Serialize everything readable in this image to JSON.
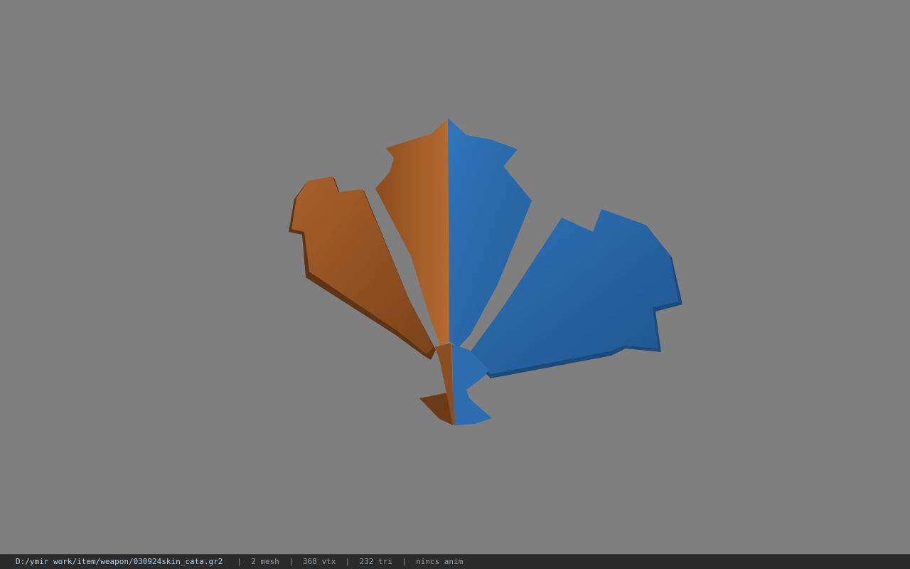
{
  "viewport": {
    "background": "#7f7f7f",
    "model": {
      "meshes": [
        {
          "name": "orange-mesh",
          "color": "#b0642a"
        },
        {
          "name": "blue-mesh",
          "color": "#2e6fb3"
        }
      ]
    }
  },
  "status": {
    "file_path": "D:/ymir work/item/weapon/030924skin_cata.gr2",
    "separator": "|",
    "mesh_count": "2 mesh",
    "vertex_count": "368 vtx",
    "triangle_count": "232 tri",
    "anim": "nincs anim"
  }
}
